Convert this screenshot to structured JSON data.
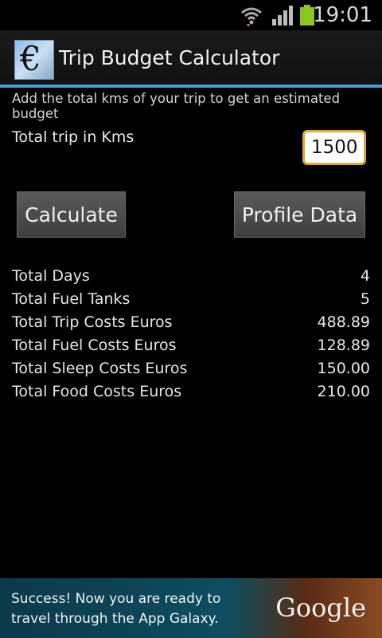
{
  "status_bar": {
    "time": "19:01",
    "icons": [
      "wifi-icon",
      "signal-icon",
      "battery-icon"
    ],
    "battery_color": "#8fc31f"
  },
  "app_bar": {
    "title": "Trip Budget Calculator",
    "icon_glyph": "€",
    "accent_color": "#4a9fd2"
  },
  "form": {
    "subtitle": "Add the total kms of your trip to get an estimated budget",
    "trip_label": "Total trip in Kms",
    "trip_value": "1500"
  },
  "buttons": {
    "calculate": "Calculate",
    "profile": "Profile Data"
  },
  "results": [
    {
      "label": "Total Days",
      "value": "4"
    },
    {
      "label": "Total Fuel Tanks",
      "value": "5"
    },
    {
      "label": "Total Trip Costs Euros",
      "value": "488.89"
    },
    {
      "label": "Total Fuel Costs Euros",
      "value": "128.89"
    },
    {
      "label": "Total Sleep Costs Euros",
      "value": "150.00"
    },
    {
      "label": "Total Food Costs Euros",
      "value": "210.00"
    }
  ],
  "ad": {
    "line1": "Success! Now you are ready to",
    "line2": "travel through the App Galaxy.",
    "brand": "Google"
  }
}
